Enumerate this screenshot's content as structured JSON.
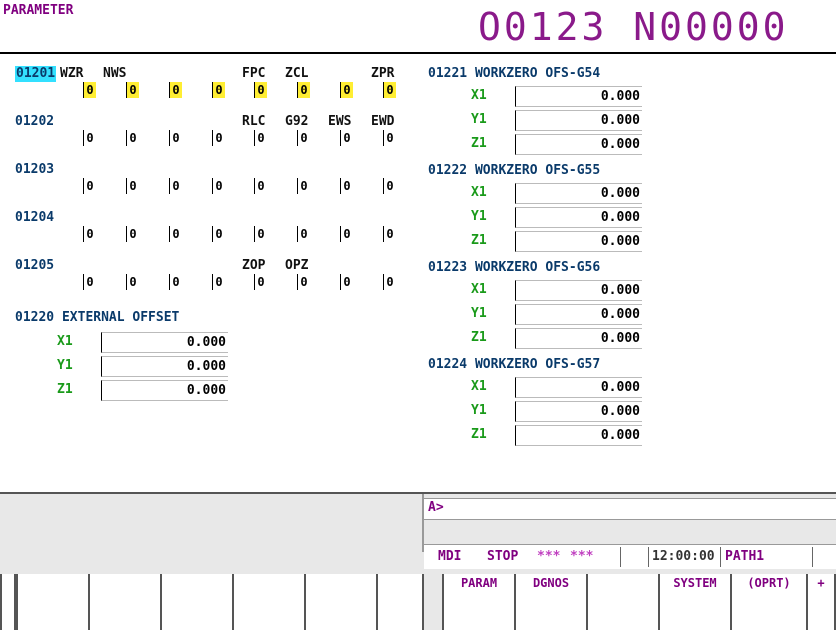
{
  "header": {
    "title": "PARAMETER",
    "program": "O0123",
    "sequence": "N00000"
  },
  "bit_params": [
    {
      "number": "01201",
      "selected": true,
      "names": [
        "WZR",
        "NWS",
        "",
        "",
        "FPC",
        "ZCL",
        "",
        "ZPR"
      ],
      "bits": [
        "0",
        "0",
        "0",
        "0",
        "0",
        "0",
        "0",
        "0"
      ]
    },
    {
      "number": "01202",
      "selected": false,
      "names": [
        "",
        "",
        "",
        "",
        "RLC",
        "G92",
        "EWS",
        "EWD"
      ],
      "bits": [
        "0",
        "0",
        "0",
        "0",
        "0",
        "0",
        "0",
        "0"
      ]
    },
    {
      "number": "01203",
      "selected": false,
      "names": [
        "",
        "",
        "",
        "",
        "",
        "",
        "",
        ""
      ],
      "bits": [
        "0",
        "0",
        "0",
        "0",
        "0",
        "0",
        "0",
        "0"
      ]
    },
    {
      "number": "01204",
      "selected": false,
      "names": [
        "",
        "",
        "",
        "",
        "",
        "",
        "",
        ""
      ],
      "bits": [
        "0",
        "0",
        "0",
        "0",
        "0",
        "0",
        "0",
        "0"
      ]
    },
    {
      "number": "01205",
      "selected": false,
      "names": [
        "",
        "",
        "",
        "",
        "ZOP",
        "OPZ",
        "",
        ""
      ],
      "bits": [
        "0",
        "0",
        "0",
        "0",
        "0",
        "0",
        "0",
        "0"
      ]
    }
  ],
  "external_offset": {
    "title": "01220 EXTERNAL  OFFSET",
    "axes": [
      {
        "axis": "X1",
        "value": "0.000"
      },
      {
        "axis": "Y1",
        "value": "0.000"
      },
      {
        "axis": "Z1",
        "value": "0.000"
      }
    ]
  },
  "workzero": [
    {
      "title": "01221 WORKZERO OFS-G54",
      "axes": [
        {
          "axis": "X1",
          "value": "0.000"
        },
        {
          "axis": "Y1",
          "value": "0.000"
        },
        {
          "axis": "Z1",
          "value": "0.000"
        }
      ]
    },
    {
      "title": "01222 WORKZERO OFS-G55",
      "axes": [
        {
          "axis": "X1",
          "value": "0.000"
        },
        {
          "axis": "Y1",
          "value": "0.000"
        },
        {
          "axis": "Z1",
          "value": "0.000"
        }
      ]
    },
    {
      "title": "01223 WORKZERO OFS-G56",
      "axes": [
        {
          "axis": "X1",
          "value": "0.000"
        },
        {
          "axis": "Y1",
          "value": "0.000"
        },
        {
          "axis": "Z1",
          "value": "0.000"
        }
      ]
    },
    {
      "title": "01224 WORKZERO OFS-G57",
      "axes": [
        {
          "axis": "X1",
          "value": "0.000"
        },
        {
          "axis": "Y1",
          "value": "0.000"
        },
        {
          "axis": "Z1",
          "value": "0.000"
        }
      ]
    }
  ],
  "input": {
    "prompt": "A>"
  },
  "status": {
    "mode": "MDI",
    "state": "STOP",
    "flags1": "***",
    "flags2": "***",
    "clock": "12:00:00",
    "path": "PATH1"
  },
  "softkeys": [
    "PARAM",
    "DGNOS",
    "",
    "SYSTEM",
    "(OPRT)",
    "+"
  ],
  "colors": {
    "selected_param": "#33e0ff",
    "bit_highlight": "#ffee33",
    "axis_label": "#1a9a1a",
    "softkey_text": "#800080"
  }
}
